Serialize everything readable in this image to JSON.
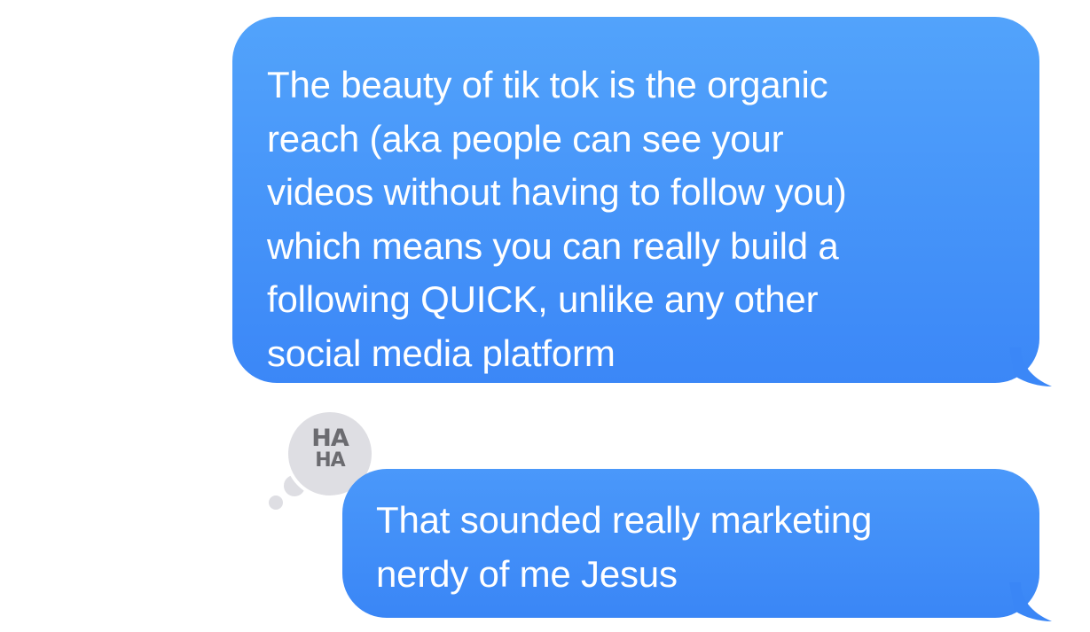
{
  "conversation": {
    "messages": [
      {
        "lines": [
          "The beauty of tik tok is the organic",
          "reach (aka people can see your",
          "videos without having to follow you)",
          "which means you can really build a",
          "following QUICK, unlike any other",
          "social media platform"
        ]
      },
      {
        "lines": [
          "That sounded really marketing",
          "nerdy of me Jesus"
        ],
        "tapback": {
          "line1": "HA",
          "line2": "HA",
          "icon": "haha-reaction-icon"
        }
      }
    ]
  },
  "colors": {
    "bubble_top": "#52a3fb",
    "bubble_bottom": "#3b87f7",
    "bubble_text": "#ffffff",
    "tapback_background": "#dedee3",
    "tapback_text": "#6b6b70",
    "background": "#ffffff"
  }
}
